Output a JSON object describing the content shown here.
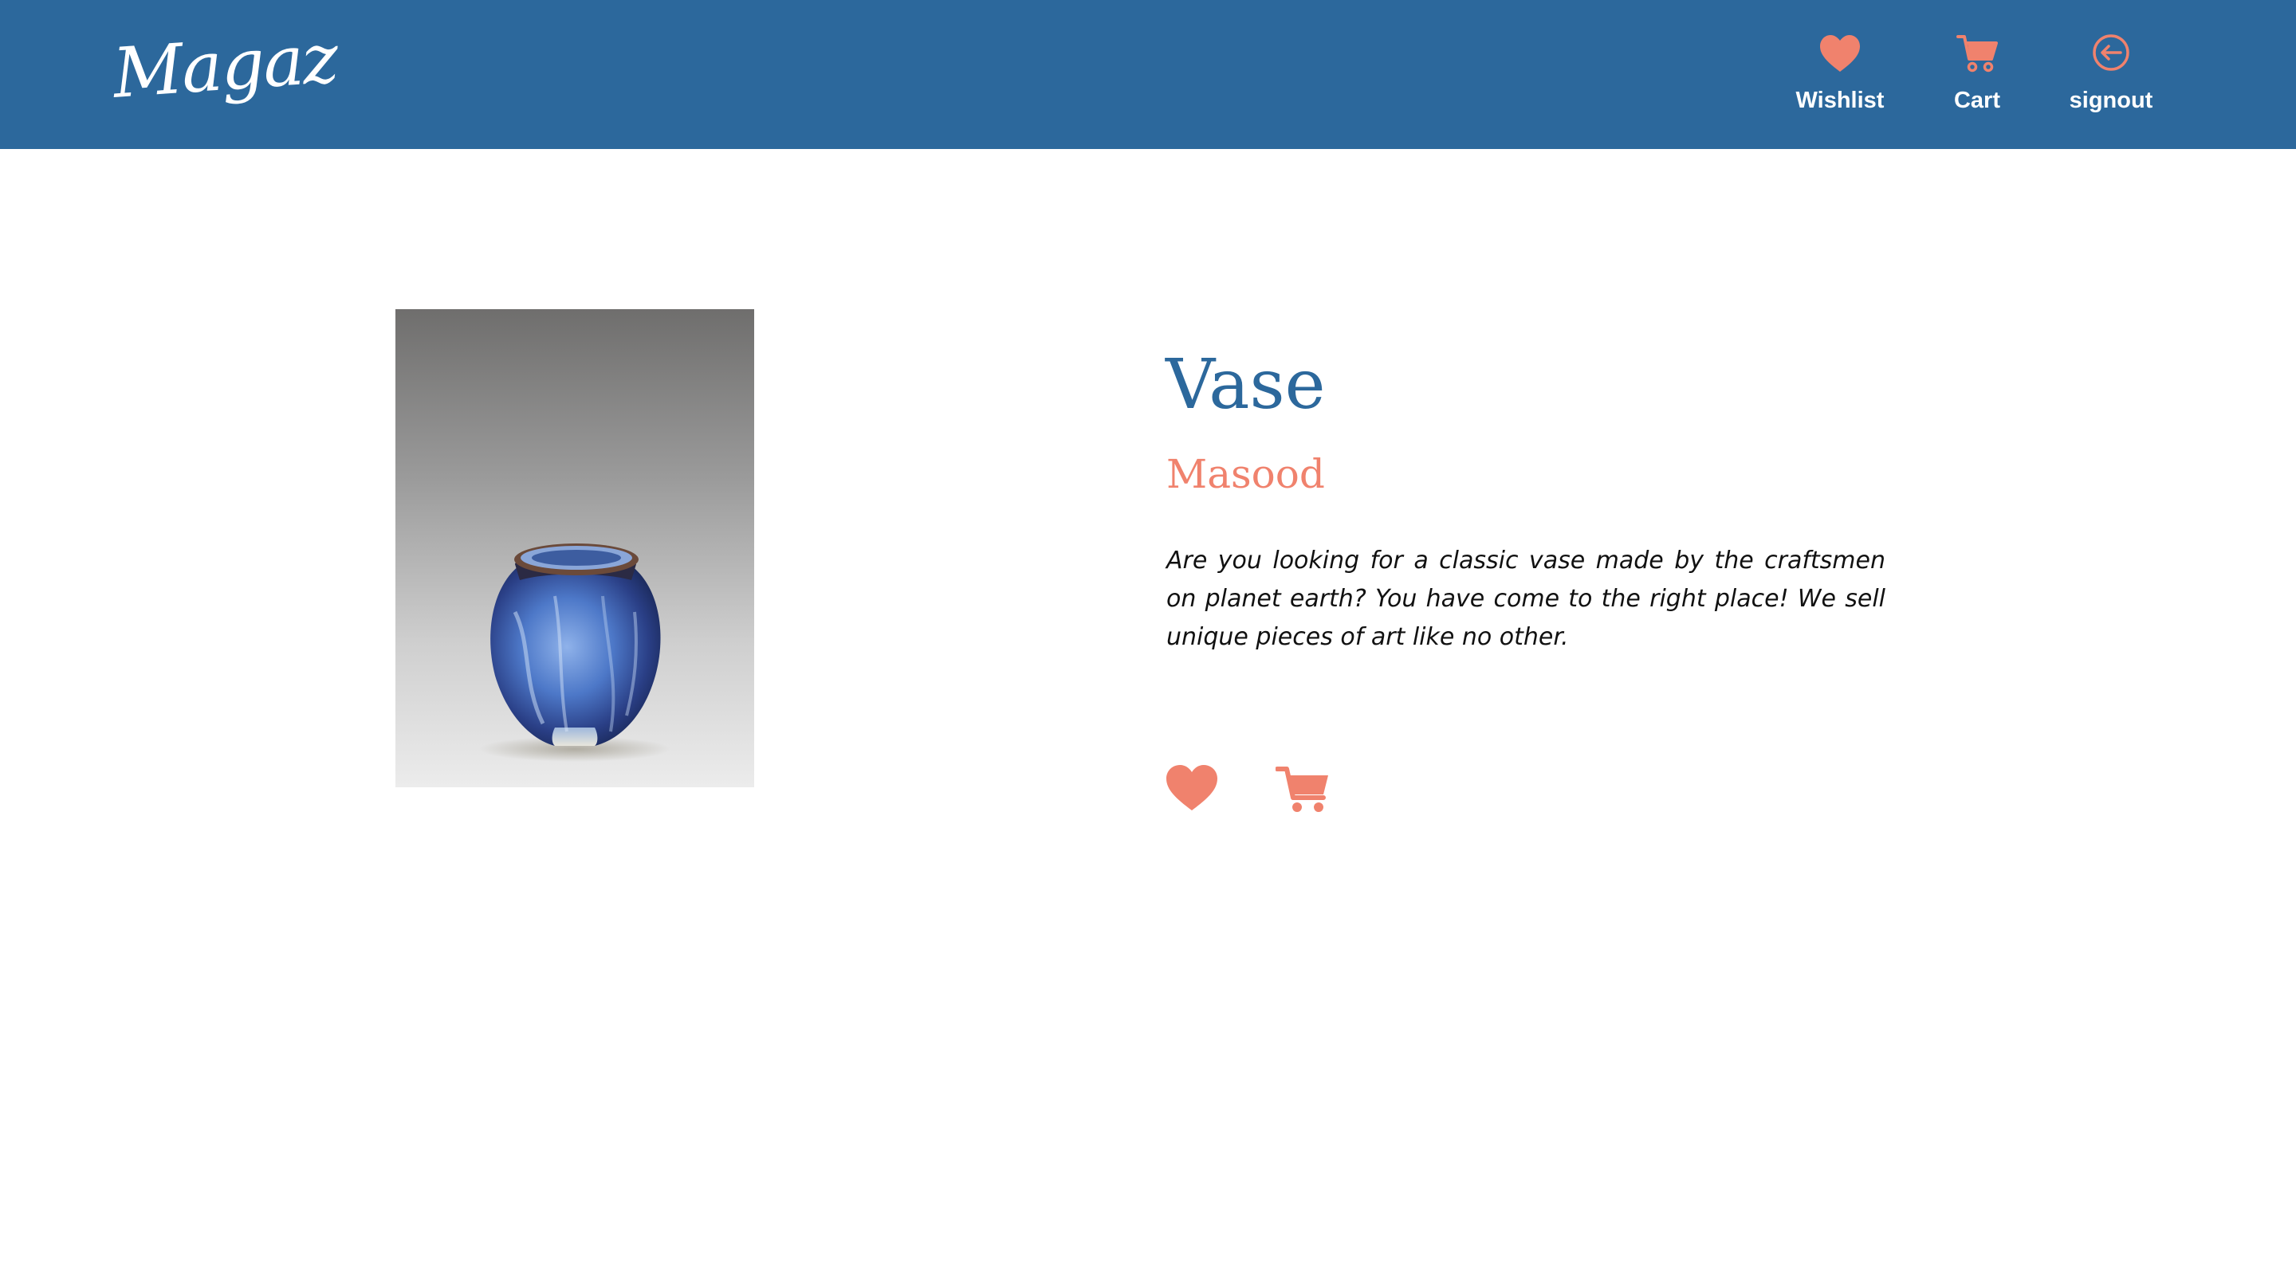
{
  "header": {
    "logo_text": "Magaz",
    "background_color": "#2c689c",
    "nav": [
      {
        "label": "Wishlist",
        "icon": "heart-icon"
      },
      {
        "label": "Cart",
        "icon": "cart-icon"
      },
      {
        "label": "signout",
        "icon": "signout-icon"
      }
    ],
    "icon_color": "#f0826d"
  },
  "product": {
    "title": "Vase",
    "maker": "Masood",
    "description": "Are you looking for a classic vase made by the craftsmen on planet earth? You have come to the right place! We sell unique pieces of art like no other.",
    "image": "blue-glazed-ceramic-vase",
    "actions": [
      {
        "name": "add-to-wishlist",
        "icon": "heart-icon"
      },
      {
        "name": "add-to-cart",
        "icon": "cart-icon"
      }
    ]
  },
  "colors": {
    "accent": "#f0826d",
    "primary": "#2c689c",
    "text": "#111111"
  }
}
